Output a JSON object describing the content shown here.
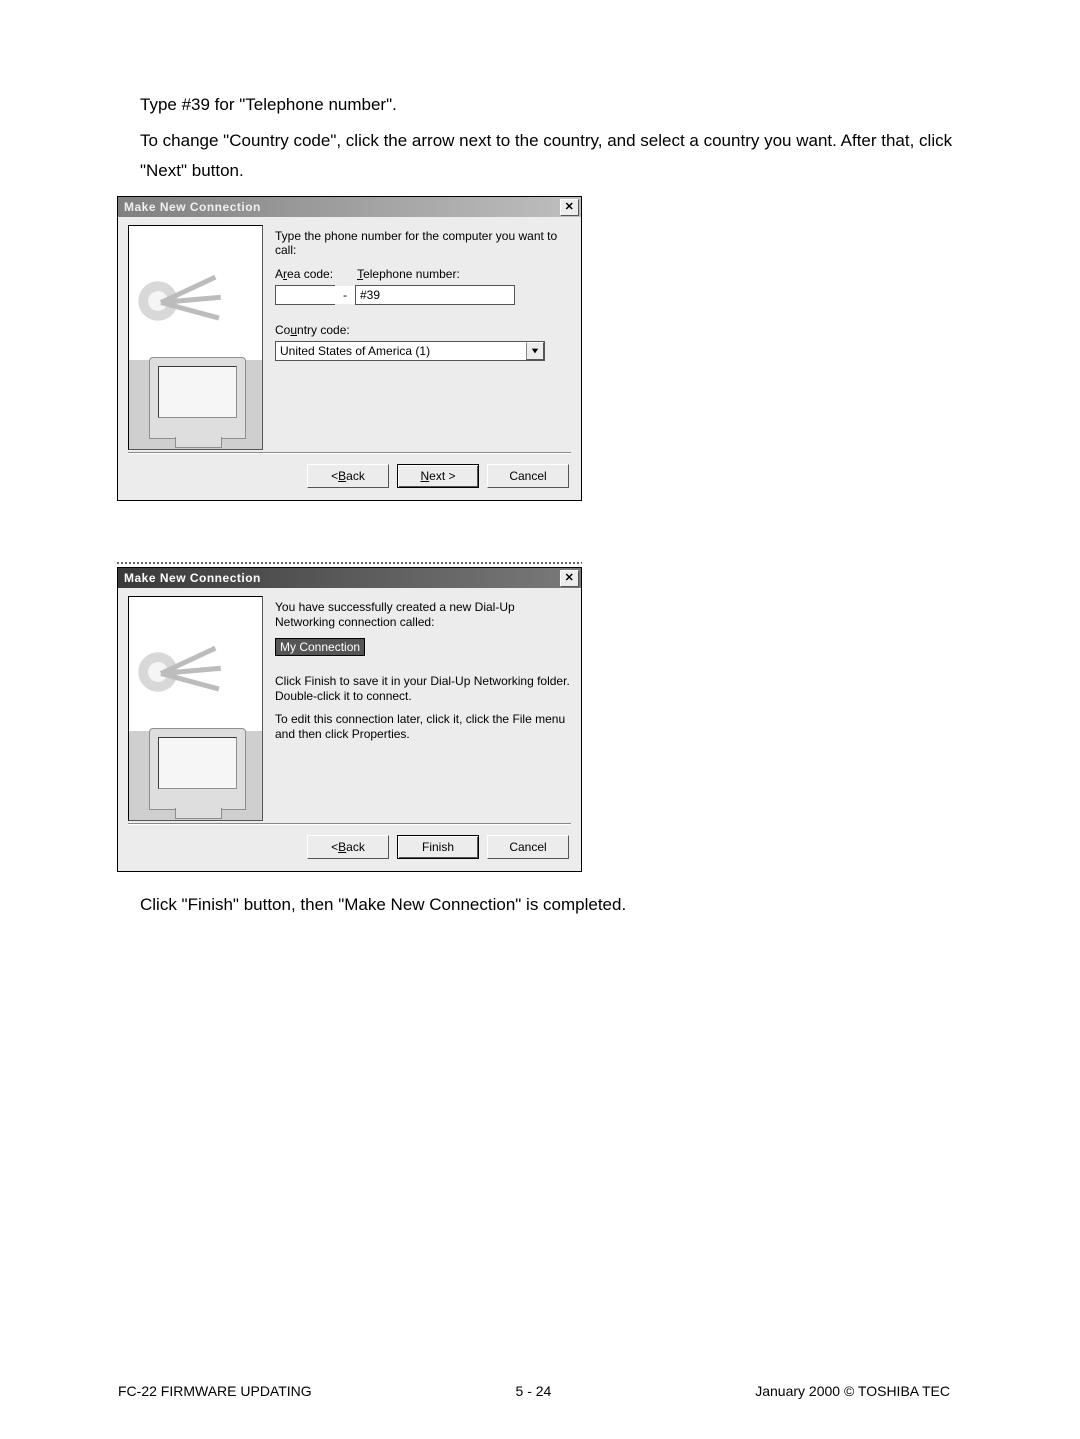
{
  "body": {
    "line1": "Type #39 for \"Telephone number\".",
    "line2": "To change \"Country code\", click the arrow next to the country, and select a country you want. After that, click \"Next\" button.",
    "line3": "Click \"Finish\" button, then \"Make New Connection\" is completed."
  },
  "dlg1": {
    "title": "Make New Connection",
    "close": "✕",
    "prompt": "Type the phone number for the computer you want to call:",
    "area_label_pre": "A",
    "area_label_u": "r",
    "area_label_post": "ea code:",
    "tel_label_u": "T",
    "tel_label_post": "elephone number:",
    "area_value": "",
    "tel_value": "#39",
    "cc_label_pre": "Co",
    "cc_label_u": "u",
    "cc_label_post": "ntry code:",
    "cc_value": "United States of America (1)",
    "btn_back_pre": "< ",
    "btn_back_u": "B",
    "btn_back_post": "ack",
    "btn_next_u": "N",
    "btn_next_post": "ext >",
    "btn_cancel": "Cancel"
  },
  "dlg2": {
    "title": "Make New Connection",
    "close": "✕",
    "para1": "You have successfully created a new Dial-Up Networking connection called:",
    "conn_name": "My Connection",
    "para2": "Click Finish to save it in your Dial-Up Networking folder. Double-click it to connect.",
    "para3": "To edit this connection later, click it, click the File menu and then click Properties.",
    "btn_back_pre": "< ",
    "btn_back_u": "B",
    "btn_back_post": "ack",
    "btn_finish": "Finish",
    "btn_cancel": "Cancel"
  },
  "footer": {
    "left": "FC-22  FIRMWARE UPDATING",
    "center": "5 - 24",
    "right": "January 2000  ©  TOSHIBA TEC"
  }
}
